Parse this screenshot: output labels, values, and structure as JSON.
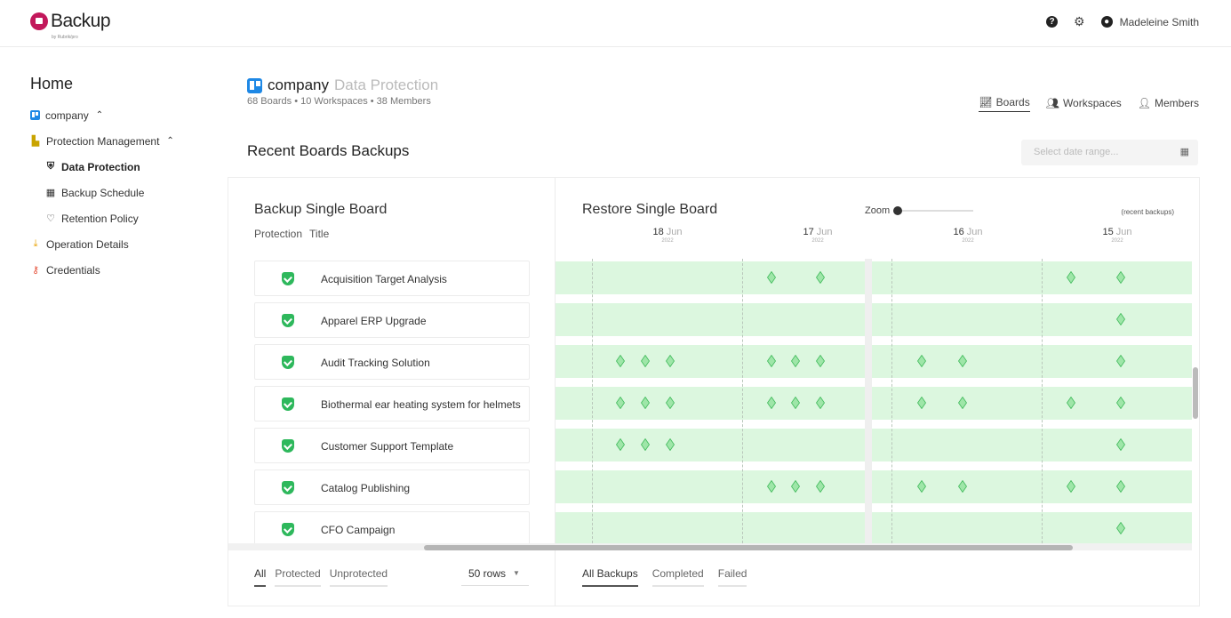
{
  "app": {
    "logo_text": "Backup",
    "logo_sub": "by Rubrik/pro"
  },
  "topbar": {
    "help_icon": "question-circle-icon",
    "settings_icon": "gear-icon",
    "user_name": "Madeleine Smith"
  },
  "sidebar": {
    "home": "Home",
    "company": "company",
    "protection_management": "Protection Management",
    "items": [
      {
        "label": "Data Protection",
        "icon": "shield-icon",
        "active": true
      },
      {
        "label": "Backup Schedule",
        "icon": "calendar-icon"
      },
      {
        "label": "Retention Policy",
        "icon": "retention-icon"
      }
    ],
    "operation_details": "Operation Details",
    "credentials": "Credentials"
  },
  "header": {
    "company": "company",
    "subtitle": "Data Protection",
    "stats": "68 Boards  • 10 Workspaces  • 38 Members",
    "tabs": [
      {
        "label": "Boards",
        "icon": "chart-icon",
        "active": true
      },
      {
        "label": "Workspaces",
        "icon": "users-icon"
      },
      {
        "label": "Members",
        "icon": "user-icon"
      }
    ]
  },
  "section_title": "Recent Boards Backups",
  "date_range": {
    "placeholder": "Select date range..."
  },
  "backup_panel": {
    "title": "Backup Single Board",
    "col_protection": "Protection",
    "col_title": "Title",
    "rows": [
      "Acquisition Target Analysis",
      "Apparel ERP Upgrade",
      "Audit Tracking Solution",
      "Biothermal ear heating system for helmets",
      "Customer Support Template",
      "Catalog Publishing",
      "CFO Campaign"
    ],
    "filters": [
      "All",
      "Protected",
      "Unprotected"
    ],
    "rows_select": "50 rows"
  },
  "restore_panel": {
    "title": "Restore Single Board",
    "zoom_label": "Zoom",
    "recent_label": "(recent backups)",
    "dates": [
      {
        "day": "18",
        "month": "Jun",
        "year": "2022"
      },
      {
        "day": "17",
        "month": "Jun",
        "year": "2022"
      },
      {
        "day": "16",
        "month": "Jun",
        "year": "2022"
      },
      {
        "day": "15",
        "month": "Jun",
        "year": "2022"
      }
    ],
    "backup_markers": [
      [
        0,
        0,
        0,
        0,
        0,
        0,
        1,
        1,
        0,
        0,
        0,
        1,
        1
      ],
      [
        0,
        0,
        0,
        0,
        0,
        0,
        0,
        0,
        0,
        0,
        0,
        0,
        1
      ],
      [
        1,
        1,
        1,
        1,
        1,
        1,
        0,
        0,
        1,
        1,
        0,
        0,
        1
      ],
      [
        1,
        1,
        1,
        1,
        1,
        1,
        0,
        0,
        1,
        1,
        1,
        0,
        1
      ],
      [
        1,
        1,
        1,
        0,
        0,
        0,
        0,
        0,
        0,
        0,
        0,
        0,
        1
      ],
      [
        0,
        0,
        0,
        1,
        1,
        1,
        0,
        0,
        1,
        1,
        1,
        0,
        1
      ],
      [
        0,
        0,
        0,
        0,
        0,
        0,
        0,
        0,
        0,
        0,
        0,
        0,
        1
      ]
    ],
    "filters": [
      "All Backups",
      "Completed",
      "Failed"
    ]
  },
  "colors": {
    "protected": "#2eb85c",
    "band": "#dcf7df",
    "diamond": "#9ee6a8",
    "trello": "#1e88e5",
    "brand": "#c2185b"
  }
}
